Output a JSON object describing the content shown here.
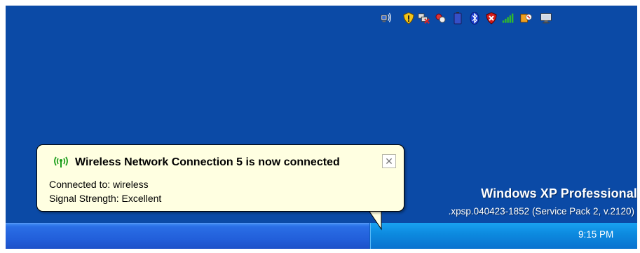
{
  "desktop": {
    "os_name": "Windows XP Professional",
    "build_info": ".xpsp.040423-1852 (Service Pack 2, v.2120)"
  },
  "notification": {
    "title": "Wireless Network Connection 5 is now connected",
    "line1": "Connected to: wireless",
    "line2": "Signal Strength: Excellent",
    "close_glyph": "✕",
    "icon": "wireless-signal-icon"
  },
  "tray": {
    "clock": "9:15 PM",
    "icons": [
      "wireless-network-icon",
      "security-shield-icon",
      "network-disconnected-icon",
      "connection-icon",
      "battery-icon",
      "bluetooth-icon",
      "security-alert-icon",
      "signal-bars-icon",
      "utility-icon",
      "monitor-icon"
    ]
  },
  "colors": {
    "desktop_bg": "#0b4aa6",
    "taskbar": "#225fda",
    "tray": "#0d8be0",
    "balloon_bg": "#ffffe1"
  }
}
